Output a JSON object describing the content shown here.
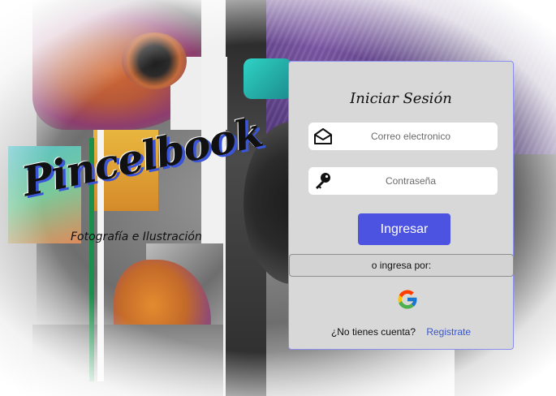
{
  "brand": {
    "title": "Pincelbook",
    "subtitle": "Fotografía e Ilustración"
  },
  "login": {
    "title": "Iniciar Sesión",
    "email_placeholder": "Correo electronico",
    "email_icon": "envelope-icon",
    "password_placeholder": "Contraseña",
    "password_icon": "key-icon",
    "submit_label": "Ingresar",
    "alt_login_label": "o ingresa por:",
    "google_icon": "google-icon",
    "signup_prompt": "¿No tienes cuenta?",
    "signup_link": "Registrate"
  },
  "colors": {
    "accent": "#4b53e0",
    "link": "#3a56c8",
    "card": "#d8d8d8"
  }
}
